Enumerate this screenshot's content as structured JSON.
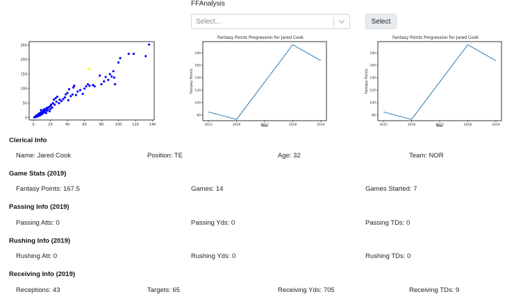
{
  "header": {
    "app_title": "FFAnalysis",
    "select_placeholder": "Select...",
    "select_button": "Select"
  },
  "chart_data": [
    {
      "type": "scatter",
      "x_ticks": [
        "0",
        "20",
        "40",
        "60",
        "80",
        "100",
        "120",
        "140"
      ],
      "y_ticks": [
        "0",
        "50",
        "100",
        "150",
        "200",
        "250"
      ],
      "xlim": [
        -5,
        142
      ],
      "ylim": [
        -8,
        262
      ],
      "highlight_color": "#ffff00",
      "point_color": "#0000ff",
      "points": [
        [
          1,
          1
        ],
        [
          2,
          2
        ],
        [
          3,
          3
        ],
        [
          3,
          6
        ],
        [
          4,
          4
        ],
        [
          4,
          8
        ],
        [
          5,
          5
        ],
        [
          5,
          9
        ],
        [
          6,
          6
        ],
        [
          6,
          12
        ],
        [
          7,
          10
        ],
        [
          7,
          15
        ],
        [
          8,
          8
        ],
        [
          8,
          14
        ],
        [
          9,
          18
        ],
        [
          9,
          26
        ],
        [
          10,
          12
        ],
        [
          10,
          20
        ],
        [
          11,
          15
        ],
        [
          12,
          22
        ],
        [
          12,
          28
        ],
        [
          13,
          18
        ],
        [
          14,
          25
        ],
        [
          14,
          30
        ],
        [
          15,
          16
        ],
        [
          16,
          24
        ],
        [
          16,
          34
        ],
        [
          17,
          28
        ],
        [
          18,
          36
        ],
        [
          19,
          22
        ],
        [
          20,
          30
        ],
        [
          20,
          40
        ],
        [
          21,
          45
        ],
        [
          22,
          35
        ],
        [
          23,
          50
        ],
        [
          24,
          62
        ],
        [
          25,
          45
        ],
        [
          26,
          67
        ],
        [
          27,
          55
        ],
        [
          28,
          72
        ],
        [
          30,
          50
        ],
        [
          31,
          62
        ],
        [
          33,
          57
        ],
        [
          35,
          64
        ],
        [
          37,
          70
        ],
        [
          38,
          80
        ],
        [
          40,
          85
        ],
        [
          41,
          60
        ],
        [
          42,
          98
        ],
        [
          44,
          74
        ],
        [
          46,
          80
        ],
        [
          47,
          104
        ],
        [
          48,
          110
        ],
        [
          50,
          78
        ],
        [
          52,
          90
        ],
        [
          55,
          95
        ],
        [
          58,
          82
        ],
        [
          60,
          100
        ],
        [
          62,
          108
        ],
        [
          64,
          115
        ],
        [
          66,
          110
        ],
        [
          70,
          112
        ],
        [
          72,
          108
        ],
        [
          78,
          145
        ],
        [
          80,
          115
        ],
        [
          83,
          125
        ],
        [
          85,
          140
        ],
        [
          88,
          130
        ],
        [
          90,
          150
        ],
        [
          92,
          142
        ],
        [
          94,
          160
        ],
        [
          95,
          138
        ],
        [
          96,
          115
        ],
        [
          100,
          190
        ],
        [
          102,
          205
        ],
        [
          112,
          220
        ],
        [
          118,
          220
        ],
        [
          132,
          212
        ],
        [
          136,
          252
        ]
      ],
      "highlight_point": [
        65,
        168
      ]
    },
    {
      "type": "line",
      "title": "Fantasy Points Progression for Jared Cook",
      "xlabel": "Year",
      "ylabel": "Fantasy Points",
      "x": [
        2015,
        2016,
        2017,
        2018,
        2019
      ],
      "x_ticks": [
        "2015",
        "2016",
        "2017",
        "2018",
        "2019"
      ],
      "y_ticks": [
        "80",
        "100",
        "120",
        "140",
        "160",
        "180"
      ],
      "xlim": [
        2014.8,
        2019.2
      ],
      "ylim": [
        71,
        198
      ],
      "series": [
        {
          "values": [
            85,
            73,
            133,
            193,
            167.5
          ],
          "color": "#1f77b4"
        }
      ]
    },
    {
      "type": "line",
      "title": "Fantasy Points Progression for Jared Cook",
      "xlabel": "Year",
      "ylabel": "Fantasy Points",
      "x": [
        2015,
        2016,
        2017,
        2018,
        2019
      ],
      "x_ticks": [
        "2015",
        "2016",
        "2017",
        "2018",
        "2019"
      ],
      "y_ticks": [
        "80",
        "100",
        "120",
        "140",
        "160",
        "180"
      ],
      "xlim": [
        2014.8,
        2019.2
      ],
      "ylim": [
        71,
        198
      ],
      "series": [
        {
          "values": [
            85,
            73,
            133,
            193,
            167.5
          ],
          "color": "#1f77b4"
        }
      ]
    }
  ],
  "sections": {
    "clerical": {
      "title": "Clerical Info",
      "name": "Name: Jared Cook",
      "position": "Position: TE",
      "age": "Age: 32",
      "team": "Team: NOR"
    },
    "game": {
      "title": "Game Stats (2019)",
      "points": "Fantasy Points: 167.5",
      "games": "Games: 14",
      "started": "Games Started: 7"
    },
    "passing": {
      "title": "Passing Info (2019)",
      "atts": "Passing Atts: 0",
      "yds": "Passing Yds: 0",
      "tds": "Passing TDs: 0"
    },
    "rushing": {
      "title": "Rushing Info (2019)",
      "att": "Rushing Att: 0",
      "yds": "Rushing Yds: 0",
      "tds": "Rushing TDs: 0"
    },
    "receiving": {
      "title": "Receiving Info (2019)",
      "rec": "Receptions: 43",
      "targets": "Targets: 65",
      "yds": "Receiving Yds: 705",
      "tds": "Receiving TDs: 9"
    }
  }
}
